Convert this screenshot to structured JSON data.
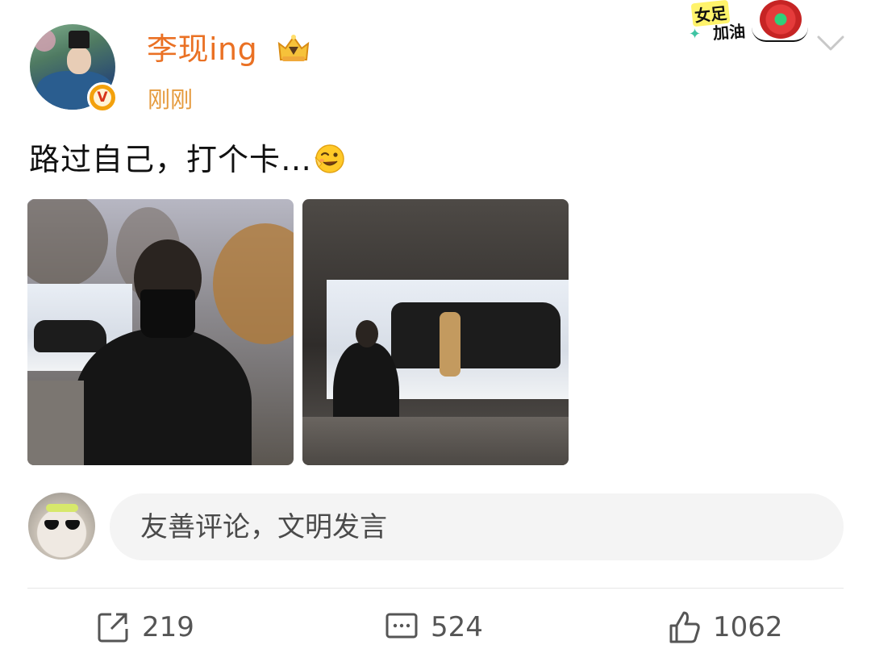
{
  "post": {
    "username": "李现ing",
    "time": "刚刚",
    "text": "路过自己，打个卡…",
    "verified_badge": "V",
    "images": [
      "photo-1",
      "photo-2"
    ]
  },
  "sticker": {
    "line1": "女足",
    "line2": "加油"
  },
  "comment": {
    "placeholder": "友善评论，文明发言"
  },
  "actions": {
    "repost_count": "219",
    "comment_count": "524",
    "like_count": "1062"
  },
  "colors": {
    "username": "#ea7124",
    "time": "#e59a3c",
    "badge": "#f3a10c"
  },
  "icons": [
    "chevron-down-icon",
    "crown-badge-icon",
    "verified-v-icon",
    "repost-icon",
    "comment-icon",
    "like-icon",
    "wink-emoji-icon"
  ]
}
